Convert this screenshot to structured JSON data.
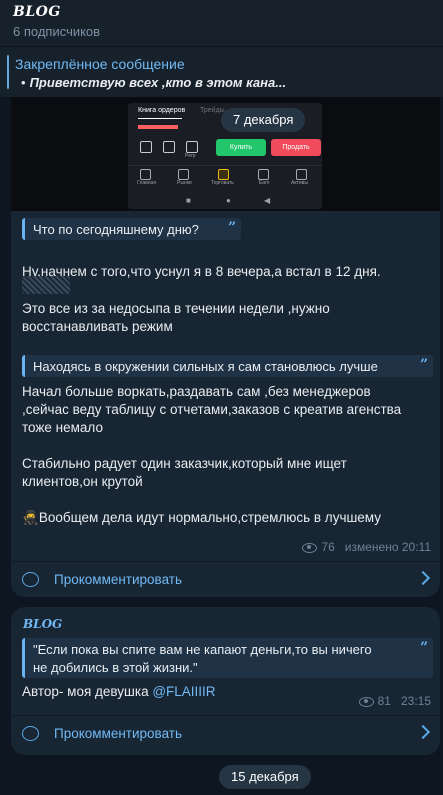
{
  "header": {
    "title": "BLOG",
    "subtitle": "6 подписчиков"
  },
  "pinned": {
    "title": "Закреплённое сообщение",
    "text": "Приветствую всех ,кто в этом кана..."
  },
  "date_separator_top": "7 декабря",
  "screenshot": {
    "tab_orders": "Книга ордеров",
    "tab_trades": "Трейды",
    "buy_label": "Купить",
    "sell_label": "Продать",
    "nav": [
      "Главная",
      "Рынки",
      "Торговать",
      "Earn",
      "Активы"
    ],
    "icon_label": "Perp"
  },
  "post1": {
    "quote1": "Что по сегодняшнему дню?",
    "para1_line1": "Ну,начнем с того,что уснул я в 8 вечера,а встал в 12 дня.",
    "para2_line1": "Это все из за недосыпа в течении недели ,нужно",
    "para2_line2": "восстанавливать режим",
    "quote2": "Находясь в окружении сильных я сам становлюсь лучше",
    "para3_line1": "Начал больше воркать,раздавать сам ,без менеджеров",
    "para3_line2": ",сейчас веду таблицу с отчетами,заказов с креатив агенства",
    "para3_line3": "тоже немало",
    "para4_line1": "Стабильно радует один заказчик,который мне ищет",
    "para4_line2": "клиентов,он крутой",
    "para5": "Вообщем дела идут нормально,стремлюсь в лучшему",
    "views": "76",
    "edited": "изменено 20:11",
    "comment_label": "Прокомментировать"
  },
  "post2": {
    "sender": "BLOG",
    "quote_line1": "\"Если пока вы спите вам не капают деньги,то вы ничего",
    "quote_line2": "не добились в этой жизни.\"",
    "author_prefix": "Автор- моя девушка ",
    "author_mention": "@FLAIIIIR",
    "views": "81",
    "time": "23:15",
    "comment_label": "Прокомментировать"
  },
  "date_separator_bottom": "15 декабря",
  "colors": {
    "accent": "#71baf5",
    "background": "#0e1621",
    "bubble": "#182533",
    "buy": "#23c76b",
    "sell": "#f04b5b"
  }
}
